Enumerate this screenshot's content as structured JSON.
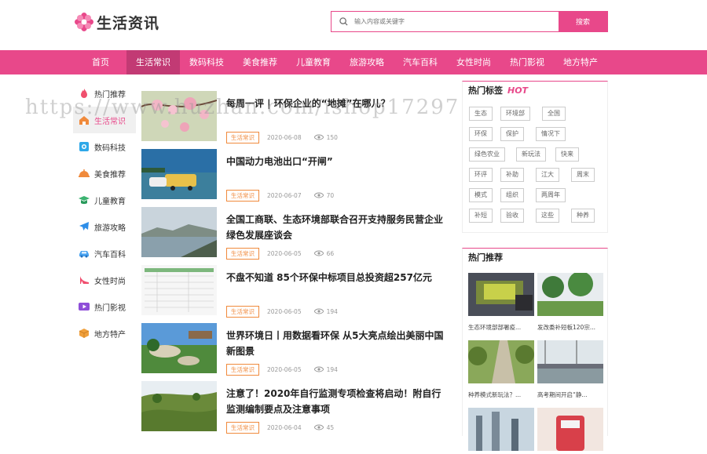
{
  "header": {
    "logo_text": "生活资讯",
    "search_placeholder": "输入内容或关键字",
    "search_button": "搜索"
  },
  "nav": [
    "首页",
    "生活常识",
    "数码科技",
    "美食推荐",
    "儿童教育",
    "旅游攻略",
    "汽车百科",
    "女性时尚",
    "热门影视",
    "地方特产"
  ],
  "nav_active": "生活常识",
  "watermark": "https://www.huzhan.com/ishop17297",
  "sidebar": [
    {
      "label": "热门推荐",
      "icon": "flame-icon",
      "color": "#f0506e"
    },
    {
      "label": "生活常识",
      "icon": "home-icon",
      "color": "#f08a3c"
    },
    {
      "label": "数码科技",
      "icon": "camera-icon",
      "color": "#2ea8e8"
    },
    {
      "label": "美食推荐",
      "icon": "food-icon",
      "color": "#f08a3c"
    },
    {
      "label": "儿童教育",
      "icon": "graduation-cap-icon",
      "color": "#3cb371"
    },
    {
      "label": "旅游攻略",
      "icon": "airplane-icon",
      "color": "#2e8ee8"
    },
    {
      "label": "汽车百科",
      "icon": "car-icon",
      "color": "#4aa3f0"
    },
    {
      "label": "女性时尚",
      "icon": "high-heel-icon",
      "color": "#f04e6e"
    },
    {
      "label": "热门影视",
      "icon": "video-play-icon",
      "color": "#8e4ed8"
    },
    {
      "label": "地方特产",
      "icon": "box-icon",
      "color": "#f0a03c"
    }
  ],
  "articles": [
    {
      "title": "每周一评 | 环保企业的“地摊”在哪儿？",
      "tag": "生活常识",
      "date": "2020-06-08",
      "views": "150"
    },
    {
      "title": "中国动力电池出口“开闸”",
      "tag": "生活常识",
      "date": "2020-06-07",
      "views": "70"
    },
    {
      "title": "全国工商联、生态环境部联合召开支持服务民营企业绿色发展座谈会",
      "tag": "生活常识",
      "date": "2020-06-05",
      "views": "66"
    },
    {
      "title": "不盘不知道 85个环保中标项目总投资超257亿元",
      "tag": "生活常识",
      "date": "2020-06-05",
      "views": "194"
    },
    {
      "title": "世界环境日丨用数据看环保 从5大亮点绘出美丽中国新图景",
      "tag": "生活常识",
      "date": "2020-06-05",
      "views": "194"
    },
    {
      "title": "注意了！2020年自行监测专项检查将启动！附自行监测编制要点及注意事项",
      "tag": "生活常识",
      "date": "2020-06-04",
      "views": "45"
    }
  ],
  "hot_tags": {
    "title": "热门标签",
    "hot_label": "HOT",
    "rows": [
      [
        "生态",
        "环境部",
        "全国"
      ],
      [
        "环保",
        "保护",
        "情况下"
      ],
      [
        "绿色农业",
        "新玩法",
        "快来"
      ],
      [
        "环评",
        "补助",
        "江大",
        "周末"
      ],
      [
        "模式",
        "组织",
        "两周年"
      ],
      [
        "补短",
        "验收",
        "这些",
        "种养"
      ]
    ]
  },
  "hot_recommend": {
    "title": "热门推荐",
    "items": [
      {
        "caption": "生态环境部部署疫..."
      },
      {
        "caption": "发改委补短板120宗..."
      },
      {
        "caption": "种养模式新玩法？..."
      },
      {
        "caption": "高考期间开启“静..."
      },
      {
        "caption": ""
      },
      {
        "caption": ""
      }
    ]
  }
}
